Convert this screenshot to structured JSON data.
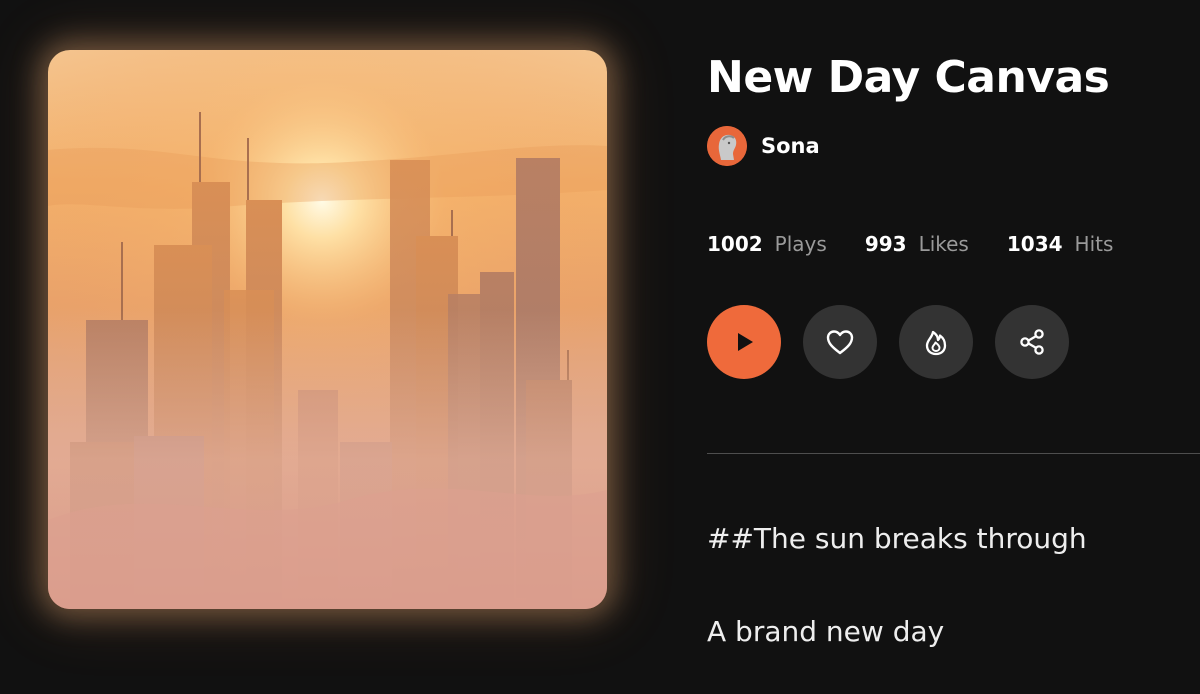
{
  "song": {
    "title": "New Day Canvas",
    "artist": "Sona",
    "cover_icon": "foggy-sunrise-skyline-image",
    "avatar_icon": "statue-head-avatar"
  },
  "stats": [
    {
      "value": "1002",
      "label": "Plays"
    },
    {
      "value": "993",
      "label": "Likes"
    },
    {
      "value": "1034",
      "label": "Hits"
    }
  ],
  "actions": [
    {
      "icon": "play-icon",
      "color": "#ef6a3b"
    },
    {
      "icon": "heart-icon",
      "color": "#333333"
    },
    {
      "icon": "flame-icon",
      "color": "#333333"
    },
    {
      "icon": "share-icon",
      "color": "#333333"
    }
  ],
  "lyrics": [
    "##The sun breaks through",
    "A brand new day"
  ],
  "colors": {
    "background": "#111111",
    "accent": "#ef6a3b",
    "muted_text": "#9a9a9a"
  }
}
